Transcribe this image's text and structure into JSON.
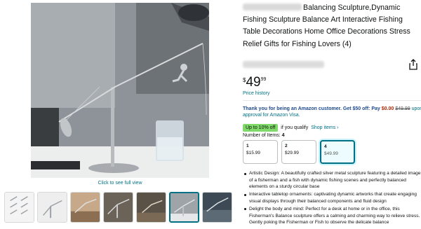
{
  "gallery": {
    "see_full_view": "Click to see full view",
    "thumbnails": [
      "thumb-1",
      "thumb-2",
      "thumb-3",
      "thumb-4",
      "thumb-5",
      "thumb-6",
      "thumb-7"
    ],
    "active_thumbnail": 6
  },
  "product": {
    "title_rest": "Balancing Sculpture,Dynamic Fishing Sculpture Balance Art Interactive Fishing Table Decorations Home Office Decorations Stress Relief Gifts for Fishing Lovers (4)",
    "share_icon": "share-icon"
  },
  "price": {
    "symbol": "$",
    "whole": "49",
    "fraction": "99",
    "history_label": "Price history"
  },
  "promo": {
    "text_a": "Thank you for being an Amazon customer. Get $50 off: Pay",
    "new_price": "$0.00",
    "old_price": "$49.99",
    "text_b": "upon",
    "line2": "approval for Amazon Visa."
  },
  "discount": {
    "badge": "Up to 10% off",
    "qualify": "if you qualify",
    "shop_items": "Shop items ›"
  },
  "quantity": {
    "label": "Number of Items:",
    "selected": "4",
    "options": [
      {
        "qty": "1",
        "price": "$15.99"
      },
      {
        "qty": "2",
        "price": "$29.99"
      },
      {
        "qty": "4",
        "price": "$49.99"
      }
    ]
  },
  "bullets": [
    "Artistic Design: A beautifully crafted silver metal sculpture featuring a detailed image of a fisherman and a fish with dynamic fishing scenes and perfectly balanced elements on a sturdy circular base",
    "Interactive tabletop ornaments: captivating dynamic artworks that create engaging visual displays through their balanced components and fluid design",
    "Delight the body and mind: Perfect for a desk at home or in the office, this Fisherman's Balance sculpture offers a calming and charming way to relieve stress. Gently poking the Fisherman or Fish to observe the delicate balance"
  ],
  "colors": {
    "link": "#007185",
    "price_red": "#b12704",
    "badge_green": "#7fda69",
    "selected_border": "#007185"
  }
}
